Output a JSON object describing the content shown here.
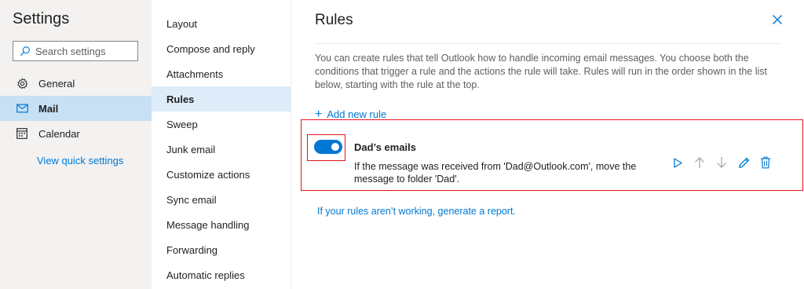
{
  "settings": {
    "title": "Settings",
    "search_placeholder": "Search settings",
    "nav": [
      {
        "label": "General",
        "icon": "gear-icon"
      },
      {
        "label": "Mail",
        "icon": "mail-icon",
        "active": true
      },
      {
        "label": "Calendar",
        "icon": "calendar-icon"
      }
    ],
    "quick_settings": "View quick settings"
  },
  "mail_menu": {
    "items": [
      "Layout",
      "Compose and reply",
      "Attachments",
      "Rules",
      "Sweep",
      "Junk email",
      "Customize actions",
      "Sync email",
      "Message handling",
      "Forwarding",
      "Automatic replies"
    ],
    "active": "Rules"
  },
  "rules": {
    "title": "Rules",
    "description": "You can create rules that tell Outlook how to handle incoming email messages. You choose both the conditions that trigger a rule and the actions the rule will take. Rules will run in the order shown in the list below, starting with the rule at the top.",
    "add_rule": "Add new rule",
    "items": [
      {
        "name": "Dad’s emails",
        "description": "If the message was received from 'Dad@Outlook.com', move the message to folder 'Dad'.",
        "enabled": true,
        "actions": [
          "play-icon",
          "arrow-up-icon",
          "arrow-down-icon",
          "pencil-icon",
          "trash-icon"
        ]
      }
    ],
    "report_link": "If your rules aren’t working, generate a report."
  },
  "colors": {
    "accent": "#0078d4",
    "highlight_box": "#e3151a",
    "active_nav": "#c7e0f4",
    "active_menu": "#deecf9"
  }
}
